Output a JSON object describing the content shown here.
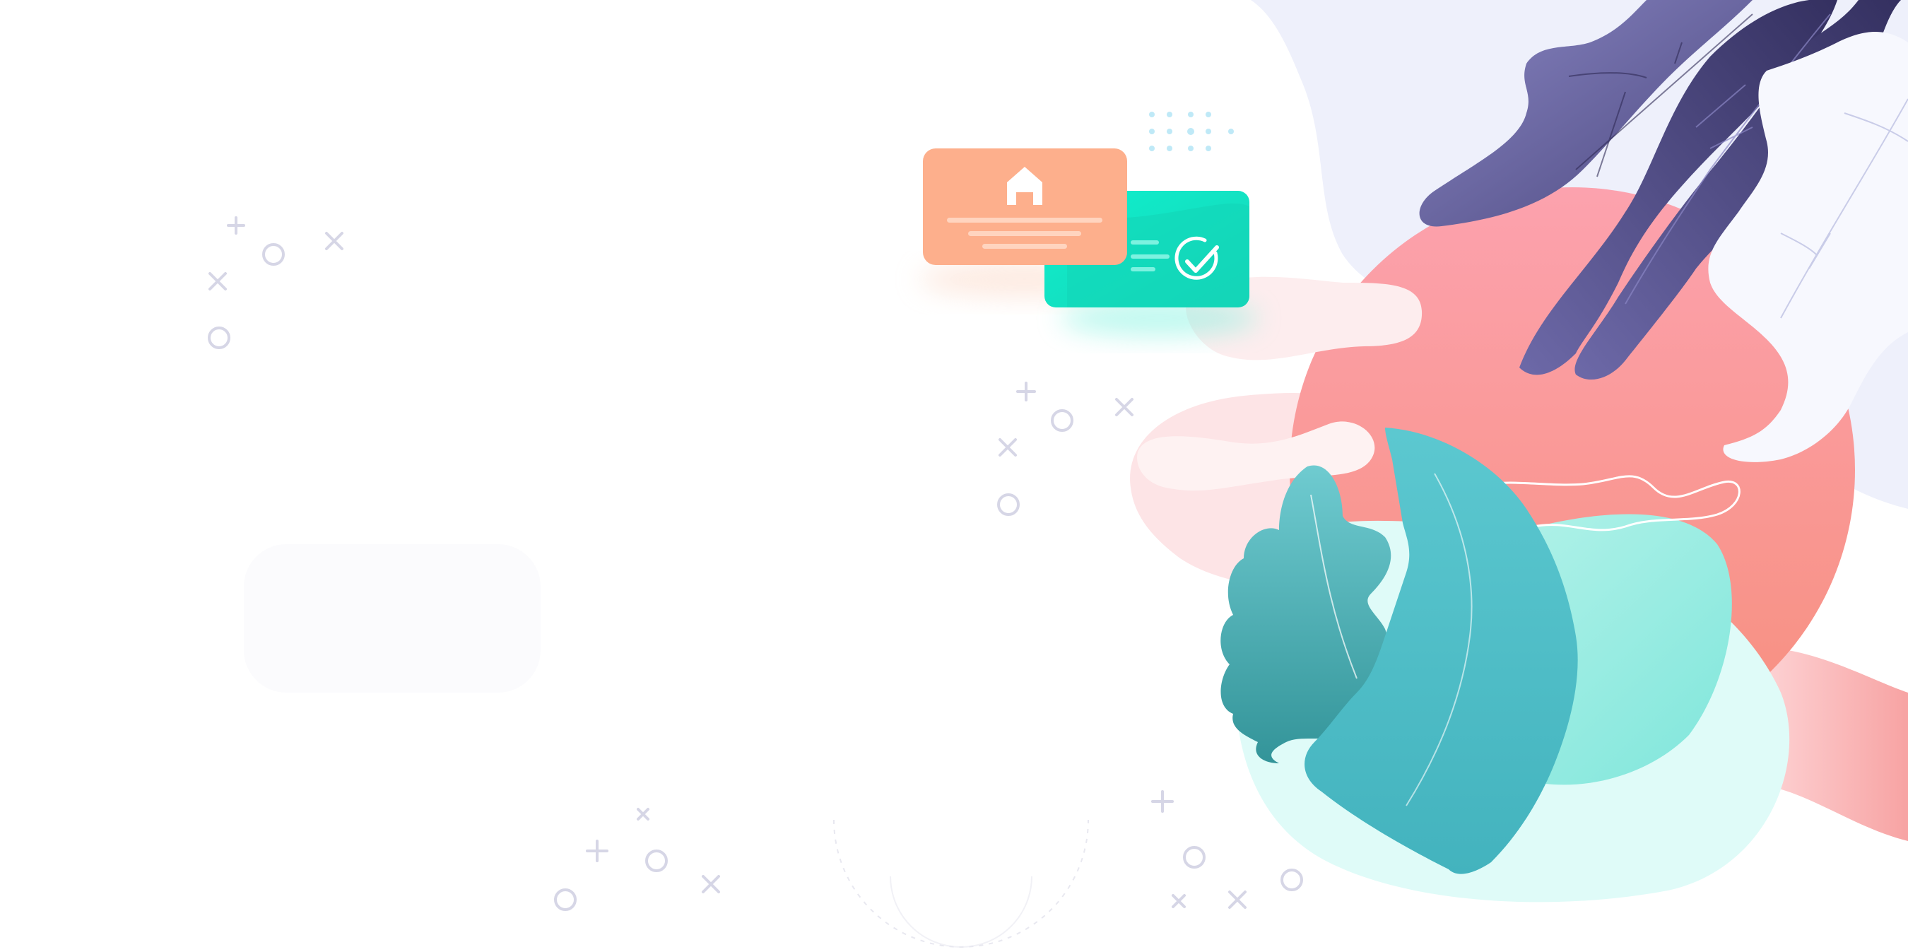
{
  "scene": {
    "description_icons": [
      "home-icon",
      "check-circle-icon"
    ],
    "colors": {
      "background": "#ffffff",
      "lavender_blob": "#EEF0FB",
      "coral_circle": "#F99A9D",
      "pink_blob": "#FDE4E6",
      "mint_blob": "#DFFBF8",
      "teal_leaf": "#4BBBC5",
      "dark_teal_leaf": "#3A9EA5",
      "purple_leaf": "#4E4A82",
      "white_leaf": "#F6F7FE",
      "orange_card": "#FDB08C",
      "green_card": "#10E6C5",
      "deco_marks": "#D6D6E6",
      "dots": "#BFE9F7"
    }
  }
}
